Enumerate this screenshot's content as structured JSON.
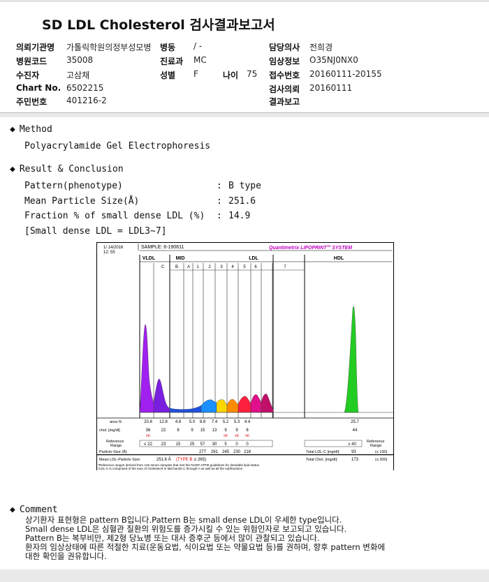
{
  "title": "SD LDL Cholesterol 검사결과보고서",
  "header": {
    "institution_label": "의뢰기관명",
    "institution": "가톨릭학원의정부성모병",
    "ward_label": "병동",
    "ward": "/ -",
    "doctor_label": "담당의사",
    "doctor": "전희경",
    "hospital_code_label": "병원코드",
    "hospital_code": "35008",
    "department_label": "진료과",
    "department": "MC",
    "clinical_info_label": "임상정보",
    "clinical_info": "O35NJ0NX0",
    "patient_label": "수진자",
    "patient": "고삼채",
    "sex_label": "성별",
    "sex": "F",
    "age_label": "나이",
    "age": "75",
    "receipt_label": "접수번호",
    "receipt": "20160111-20155",
    "chart_no_label": "Chart No.",
    "chart_no": "6502215",
    "request_date_label": "검사의뢰",
    "request_date": "20160111",
    "resident_no_label": "주민번호",
    "resident_no": "401216-2",
    "report_label": "결과보고",
    "report": ""
  },
  "method": {
    "heading": "Method",
    "text": "Polyacrylamide Gel Electrophoresis"
  },
  "result": {
    "heading": "Result & Conclusion",
    "rows": [
      {
        "label": "Pattern(phenotype)",
        "colon": ":",
        "value": "B type"
      },
      {
        "label": "Mean Particle Size(Å)",
        "colon": ":",
        "value": "251.6"
      },
      {
        "label": "Fraction % of small dense LDL (%)",
        "colon": ":",
        "value": "14.9"
      }
    ],
    "note": "[Small dense LDL = LDL3~7]"
  },
  "comment": {
    "heading": "Comment",
    "lines": [
      "상기환자 표현형은 pattern B입니다.Pattern B는 small dense LDL이 우세한 type입니다.",
      "Small dense LDL은 심혈관 질환의 위험도를 증가시킬 수 있는 위험인자로 보고되고 있습니다.",
      "Pattern B는 복부비만, 제2형 당뇨병 또는 대사 증후군 등에서 많이 관찰되고 있습니다.",
      "환자의 임상상태에 따른 적절한 치료(운동요법, 식이요법 또는 약물요법 등)를 권하며, 향후 pattern 변화에",
      "대한 확인을 권유합니다."
    ]
  },
  "chart_data": {
    "type": "area",
    "date": "1/ 14/2016",
    "time": "12: 55",
    "sample": "SAMPLE:   6-190611",
    "brand": "Quantimetrix LIPOPRINT",
    "brand_tm": "TM",
    "brand_system": " SYSTEM",
    "groups": [
      "VLDL",
      "MID",
      "LDL",
      "HDL"
    ],
    "bands": [
      {
        "name": "",
        "area": "20.8",
        "chol": "36",
        "flag": "HI",
        "range": "≤ 22",
        "color": "#a020f0"
      },
      {
        "name": "C",
        "area": "12.8",
        "chol": "22",
        "flag": "",
        "range": "23",
        "color": "#7a1fe0"
      },
      {
        "name": "B",
        "area": "4.8",
        "chol": "8",
        "flag": "",
        "range": "15",
        "color": "#2050e0"
      },
      {
        "name": "A",
        "area": "5.0",
        "chol": "9",
        "flag": "",
        "range": "25",
        "color": "#1a8fff"
      },
      {
        "name": "1",
        "area": "8.8",
        "chol": "15",
        "flag": "",
        "range": "57",
        "color": "#ffd700"
      },
      {
        "name": "2",
        "area": "7.4",
        "chol": "13",
        "flag": "",
        "range": "30",
        "color": "#ff8c00"
      },
      {
        "name": "3",
        "area": "5.2",
        "chol": "9",
        "flag": "HI",
        "range": "5",
        "color": "#ff2040"
      },
      {
        "name": "4",
        "area": "5.3",
        "chol": "9",
        "flag": "HI",
        "range": "0",
        "color": "#e0108a"
      },
      {
        "name": "5",
        "area": "4.4",
        "chol": "8",
        "flag": "HI",
        "range": "0",
        "color": "#c0106a"
      },
      {
        "name": "6",
        "area": "",
        "chol": "",
        "flag": "",
        "range": "",
        "color": "#c0c0c0"
      },
      {
        "name": "7",
        "area": "",
        "chol": "",
        "flag": "",
        "range": "",
        "color": "#c0c0c0"
      }
    ],
    "hdl": {
      "area": "25.7",
      "chol": "44",
      "range": "≥ 40",
      "color": "#22cc22"
    },
    "row_labels": {
      "area": "area %",
      "chol": "chol. [mg/dl]",
      "range1": "Reference",
      "range2": "Range"
    },
    "particle_size_label": "Particle-Size (Å)",
    "particle_sizes": [
      "277",
      "261",
      "245",
      "230",
      "218"
    ],
    "mean_size_label": "Mean LDL-Particle Size:",
    "mean_size_value": "251.6 Å",
    "mean_size_type": "(TYPE B ;",
    "mean_size_cut": "≤ 265)",
    "total_ldl_label": "Total LDL-C [mg/dl]:",
    "total_ldl_value": "93",
    "total_ldl_range": "(≤ 130)",
    "total_chol_label": "Total Chol. [mg/dl]:",
    "total_chol_value": "173",
    "total_chol_range": "(≤ 200)",
    "footnotes": [
      "*Reference ranges derived from 125 serum samples that met the NCEP ATPIII guidelines for desirable lipid status",
      "*LDL-C is comprised of the sum of cholesterol in Mid bands C through A as well as all the subfractions"
    ]
  }
}
